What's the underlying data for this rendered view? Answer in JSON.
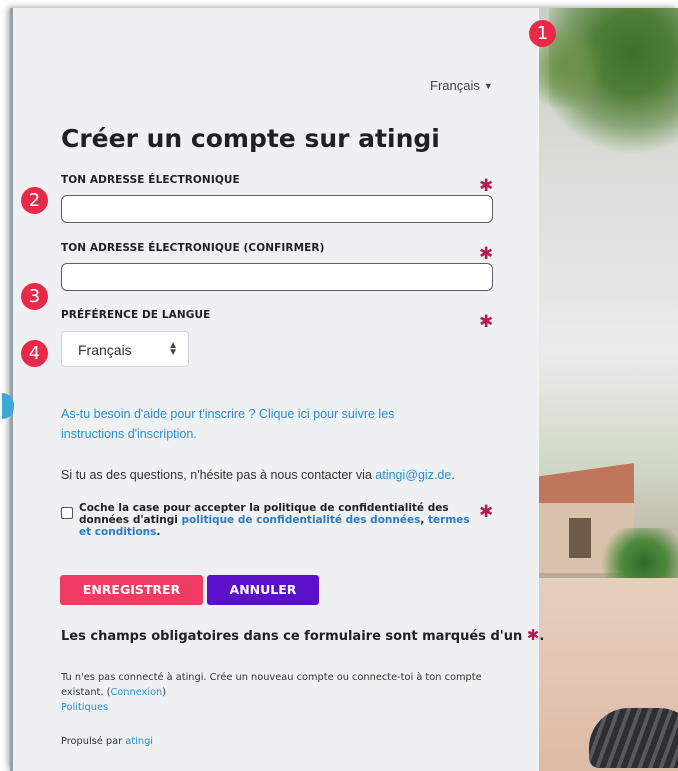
{
  "header": {
    "language_selector": "Français"
  },
  "form": {
    "title": "Créer un compte sur atingi",
    "email_label": "TON ADRESSE ÉLECTRONIQUE",
    "email_value": "",
    "email_confirm_label": "TON ADRESSE ÉLECTRONIQUE (CONFIRMER)",
    "email_confirm_value": "",
    "language_label": "PRÉFÉRENCE DE LANGUE",
    "language_value": "Français",
    "required_symbol": "✱"
  },
  "help": {
    "signup_help_link": "As-tu besoin d'aide pour t'inscrire ? Clique ici pour suivre les instructions d'inscription.",
    "contact_text": "Si tu as des questions, n'hésite pas à nous contacter via",
    "contact_email": "atingi@giz.de",
    "contact_suffix": "."
  },
  "consent": {
    "text": "Coche la case pour accepter la politique de confidentialité des données d'atingi",
    "privacy_link": "politique de confidentialité des données",
    "separator": ",",
    "terms_link": "termes et conditions",
    "end": "."
  },
  "buttons": {
    "save": "ENREGISTRER",
    "cancel": "ANNULER"
  },
  "required_note": {
    "text": "Les champs obligatoires dans ce formulaire sont marqués d'un",
    "star": "✱",
    "end": "."
  },
  "footer": {
    "not_logged_in": "Tu n'es pas connecté à atingi. Crée un nouveau compte ou connecte-toi à ton compte existant. (",
    "login_link": "Connexion",
    "login_close": ")",
    "policies_link": "Politiques",
    "powered_by": "Propulsé par",
    "powered_by_link": "atingi"
  },
  "callouts": [
    "1",
    "2",
    "3",
    "4"
  ],
  "colors": {
    "accent_pink": "#f03c63",
    "accent_purple": "#5c10c9",
    "link_blue": "#2b8fd1",
    "required_star": "#b01e52",
    "callout_red": "#e8294a"
  }
}
